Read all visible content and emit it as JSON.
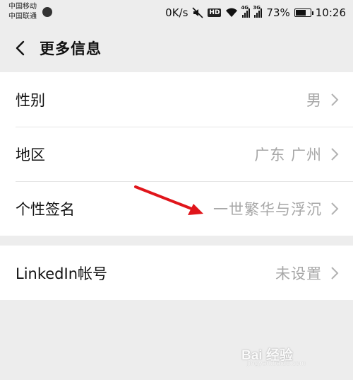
{
  "status_bar": {
    "carrier_1": "中国移动",
    "carrier_2": "中国联通",
    "net_speed": "0K/s",
    "hd": "HD",
    "signal_1_tag": "4G",
    "signal_2_tag": "3G",
    "battery": "73%",
    "battery_level": 0.73,
    "time": "10:26"
  },
  "header": {
    "title": "更多信息"
  },
  "groups": [
    [
      {
        "label": "性别",
        "value": "男"
      },
      {
        "label": "地区",
        "value": "广东 广州"
      },
      {
        "label": "个性签名",
        "value": "一世繁华与浮沉"
      }
    ],
    [
      {
        "label": "LinkedIn帐号",
        "value": "未设置"
      }
    ]
  ],
  "watermark": {
    "text": "Bai 经验",
    "sub": "jingyan.baidu.com"
  },
  "colors": {
    "background": "#ededed",
    "cell": "#ffffff",
    "secondary_text": "#a7a7a7",
    "annotation": "#e0151b"
  }
}
